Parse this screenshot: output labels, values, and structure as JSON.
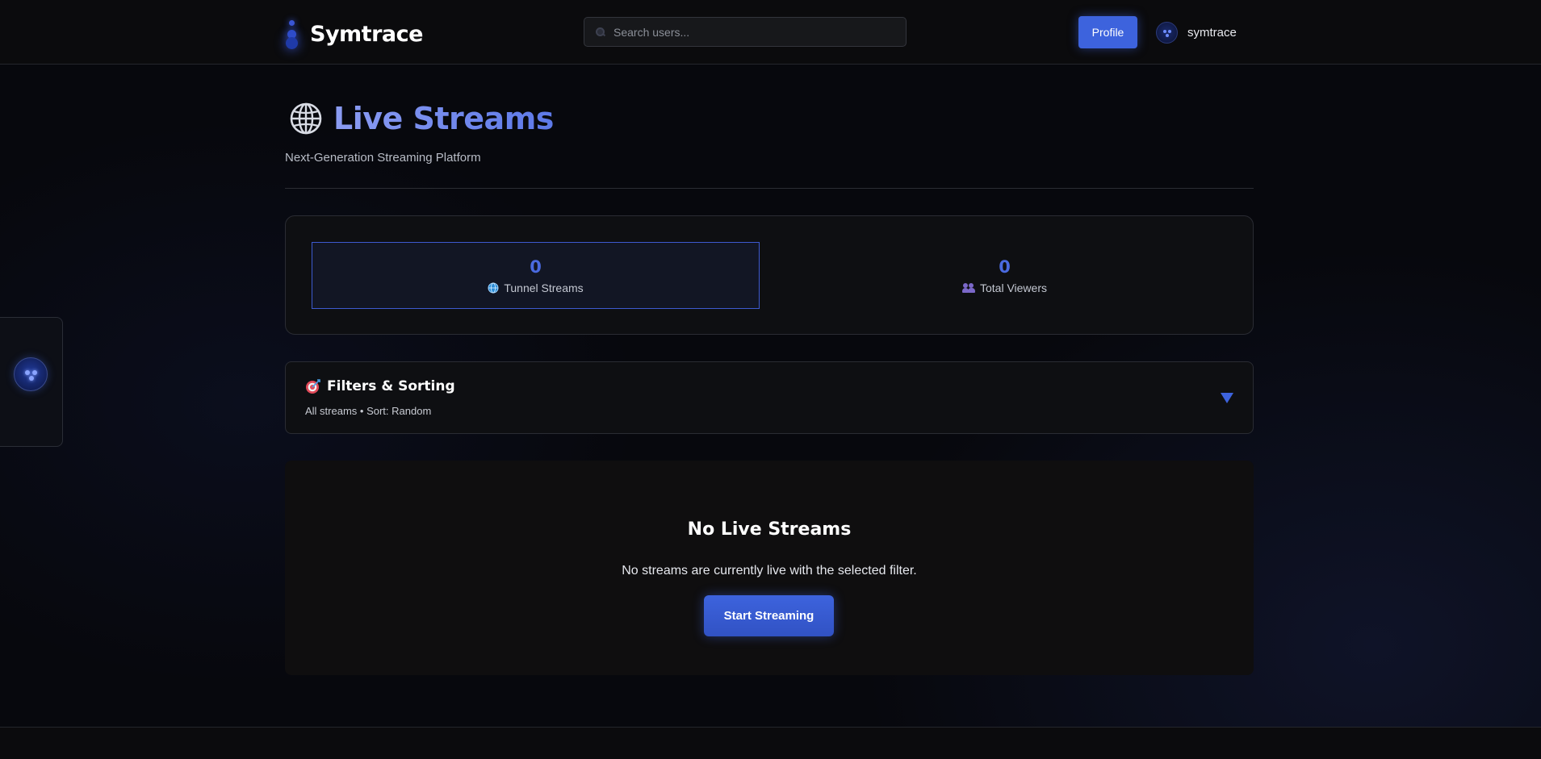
{
  "header": {
    "brand": "Symtrace",
    "search_placeholder": "Search users...",
    "profile_label": "Profile",
    "username": "symtrace"
  },
  "main": {
    "title": "Live Streams",
    "subtitle": "Next-Generation Streaming Platform",
    "stats": [
      {
        "value": "0",
        "label": "Tunnel Streams",
        "icon": "globe-icon"
      },
      {
        "value": "0",
        "label": "Total Viewers",
        "icon": "people-icon"
      }
    ],
    "filters": {
      "title": "Filters & Sorting",
      "summary": "All streams • Sort: Random",
      "icon": "target-icon"
    },
    "empty": {
      "title": "No Live Streams",
      "text": "No streams are currently live with the selected filter.",
      "button": "Start Streaming"
    }
  },
  "colors": {
    "accent": "#3d63dd",
    "background": "#07080d",
    "card": "#0e0f12"
  }
}
